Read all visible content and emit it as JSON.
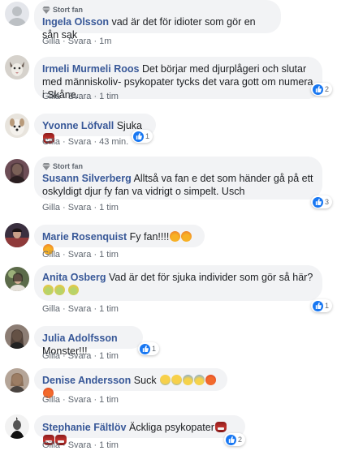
{
  "labels": {
    "badge": "Stort fan",
    "like": "Gilla",
    "reply": "Svara",
    "sep": "·"
  },
  "comments": [
    {
      "author": "Ingela Olsson",
      "badge": true,
      "text": "vad är det för idioter som gör en sån sak",
      "time": "1m",
      "reactions": null
    },
    {
      "author": "Irmeli Murmeli Roos",
      "badge": false,
      "text": "Det börjar med djurplågeri och slutar med människoliv- psykopater tycks det vara gott om numera i Skåne.",
      "time": "1 tim",
      "reactions": "2"
    },
    {
      "author": "Yvonne Löfvall",
      "badge": false,
      "text": "Sjuka",
      "emojis": [
        "ogre"
      ],
      "time": "43 min.",
      "reactions": "1"
    },
    {
      "author": "Susann Silverberg",
      "badge": true,
      "text": "Alltså va fan e det som händer gå på ett oskyldigt djur fy fan va vidrigt o simpelt. Usch",
      "time": "1 tim",
      "reactions": "3"
    },
    {
      "author": "Marie Rosenquist",
      "badge": false,
      "text": "Fy fan!!!!",
      "emojis": [
        "angry",
        "angry",
        "angry"
      ],
      "time": "1 tim",
      "reactions": null
    },
    {
      "author": "Anita Osberg",
      "badge": false,
      "text": "Vad är det för sjuka individer som gör så här?",
      "emojis": [
        "sick",
        "sick",
        "sick"
      ],
      "time": "1 tim",
      "reactions": "1"
    },
    {
      "author": "Julia Adolfsson",
      "badge": false,
      "text": "Monster!!!",
      "time": "1 tim",
      "reactions": "1"
    },
    {
      "author": "Denise Andersson",
      "badge": false,
      "text": "Suck",
      "emojis": [
        "cry",
        "cry",
        "scream",
        "scream",
        "rage",
        "rage"
      ],
      "time": "1 tim",
      "reactions": null
    },
    {
      "author": "Stephanie Fältlöv",
      "badge": false,
      "text": "Äckliga psykopater",
      "emojis": [
        "ogre",
        "ogre",
        "ogre"
      ],
      "time": "1 tim",
      "reactions": "2"
    }
  ],
  "colors": {
    "author": "#385898",
    "bubble": "#f2f3f5",
    "like": "#1877f2",
    "meta": "#606770"
  }
}
